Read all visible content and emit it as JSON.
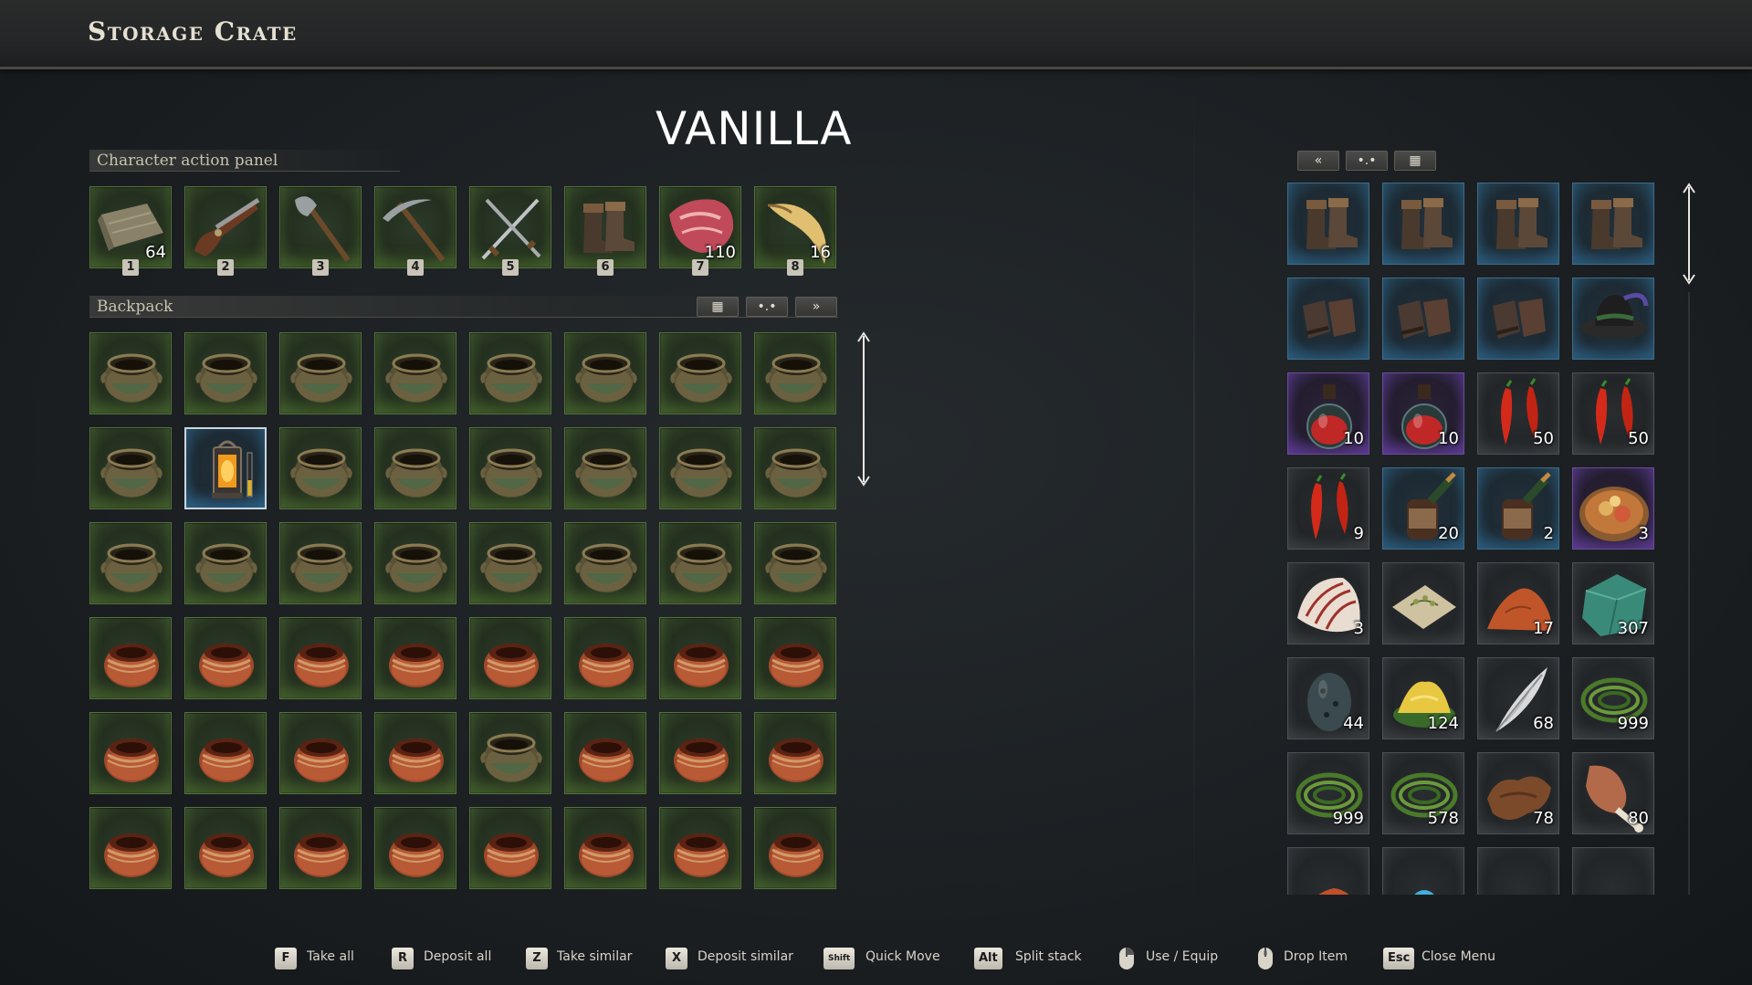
{
  "window": {
    "title": "Storage Crate"
  },
  "overlay": {
    "title": "VANILLA"
  },
  "action_panel": {
    "label": "Character action panel",
    "slots": [
      {
        "item": "cloth-icon",
        "qty": "64",
        "hotkey": "1"
      },
      {
        "item": "flintlock-pistol-icon",
        "qty": "",
        "hotkey": "2"
      },
      {
        "item": "axe-icon",
        "qty": "",
        "hotkey": "3"
      },
      {
        "item": "pickaxe-icon",
        "qty": "",
        "hotkey": "4"
      },
      {
        "item": "crossed-swords-icon",
        "qty": "",
        "hotkey": "5"
      },
      {
        "item": "boots-icon",
        "qty": "",
        "hotkey": "6"
      },
      {
        "item": "raw-meat-icon",
        "qty": "110",
        "hotkey": "7"
      },
      {
        "item": "horn-icon",
        "qty": "16",
        "hotkey": "8"
      }
    ]
  },
  "backpack": {
    "label": "Backpack",
    "buttons": {
      "grid": "▦",
      "sort": "•.•",
      "transfer": "»"
    },
    "rows": [
      [
        "green-pot",
        "green-pot",
        "green-pot",
        "green-pot",
        "green-pot",
        "green-pot",
        "green-pot",
        "green-pot"
      ],
      [
        "green-pot",
        "lantern",
        "green-pot",
        "green-pot",
        "green-pot",
        "green-pot",
        "green-pot",
        "green-pot"
      ],
      [
        "green-pot",
        "green-pot",
        "green-pot",
        "green-pot",
        "green-pot",
        "green-pot",
        "green-pot",
        "green-pot"
      ],
      [
        "clay-pot",
        "clay-pot",
        "clay-pot",
        "clay-pot",
        "clay-pot",
        "clay-pot",
        "clay-pot",
        "clay-pot"
      ],
      [
        "clay-pot",
        "clay-pot",
        "clay-pot",
        "clay-pot",
        "green-pot",
        "clay-pot",
        "clay-pot",
        "clay-pot"
      ],
      [
        "clay-pot",
        "clay-pot",
        "clay-pot",
        "clay-pot",
        "clay-pot",
        "clay-pot",
        "clay-pot",
        "clay-pot"
      ]
    ]
  },
  "storage": {
    "buttons": {
      "transfer": "«",
      "sort": "•.•",
      "grid": "▦"
    },
    "rows": [
      [
        {
          "item": "boots-icon",
          "qty": "",
          "rarity": "blue"
        },
        {
          "item": "boots-icon",
          "qty": "",
          "rarity": "blue"
        },
        {
          "item": "boots-icon",
          "qty": "",
          "rarity": "blue"
        },
        {
          "item": "boots-icon",
          "qty": "",
          "rarity": "blue"
        }
      ],
      [
        {
          "item": "gloves-icon",
          "qty": "",
          "rarity": "blue"
        },
        {
          "item": "gloves-icon",
          "qty": "",
          "rarity": "blue"
        },
        {
          "item": "gloves-icon",
          "qty": "",
          "rarity": "blue"
        },
        {
          "item": "hat-icon",
          "qty": "",
          "rarity": "blue"
        }
      ],
      [
        {
          "item": "potion-icon",
          "qty": "10",
          "rarity": "purple"
        },
        {
          "item": "potion-icon",
          "qty": "10",
          "rarity": "purple"
        },
        {
          "item": "chili-icon",
          "qty": "50",
          "rarity": "grey"
        },
        {
          "item": "chili-icon",
          "qty": "50",
          "rarity": "grey"
        }
      ],
      [
        {
          "item": "chili-icon",
          "qty": "9",
          "rarity": "grey"
        },
        {
          "item": "bottle-icon",
          "qty": "20",
          "rarity": "blue"
        },
        {
          "item": "bottle-icon",
          "qty": "2",
          "rarity": "blue"
        },
        {
          "item": "food-plate-icon",
          "qty": "3",
          "rarity": "purple"
        }
      ],
      [
        {
          "item": "shell-icon",
          "qty": "3",
          "rarity": "grey"
        },
        {
          "item": "seeds-icon",
          "qty": "",
          "rarity": "grey"
        },
        {
          "item": "clay-icon",
          "qty": "17",
          "rarity": "grey"
        },
        {
          "item": "ore-icon",
          "qty": "307",
          "rarity": "grey"
        }
      ],
      [
        {
          "item": "egg-icon",
          "qty": "44",
          "rarity": "grey"
        },
        {
          "item": "flour-icon",
          "qty": "124",
          "rarity": "grey"
        },
        {
          "item": "feather-icon",
          "qty": "68",
          "rarity": "grey"
        },
        {
          "item": "fiber-icon",
          "qty": "999",
          "rarity": "grey"
        }
      ],
      [
        {
          "item": "fiber-icon",
          "qty": "999",
          "rarity": "grey"
        },
        {
          "item": "fiber-icon",
          "qty": "578",
          "rarity": "grey"
        },
        {
          "item": "hide-icon",
          "qty": "78",
          "rarity": "grey"
        },
        {
          "item": "meat-leg-icon",
          "qty": "80",
          "rarity": "grey"
        }
      ],
      [
        {
          "item": "mushroom-icon",
          "qty": "",
          "rarity": "grey"
        },
        {
          "item": "flower-icon",
          "qty": "",
          "rarity": "grey"
        },
        {
          "item": "dirt-icon",
          "qty": "",
          "rarity": "grey"
        },
        {
          "item": "coins-icon",
          "qty": "",
          "rarity": "grey"
        }
      ]
    ]
  },
  "footer": [
    {
      "key": "F",
      "label": "Take all"
    },
    {
      "key": "R",
      "label": "Deposit all"
    },
    {
      "key": "Z",
      "label": "Take similar"
    },
    {
      "key": "X",
      "label": "Deposit similar"
    },
    {
      "key": "Shift",
      "label": "Quick Move"
    },
    {
      "key": "Alt",
      "label": "Split stack"
    },
    {
      "key": "mouse-right-icon",
      "label": "Use / Equip"
    },
    {
      "key": "mouse-middle-icon",
      "label": "Drop Item"
    },
    {
      "key": "Esc",
      "label": "Close Menu"
    }
  ],
  "colors": {
    "green_slot": "#55703f",
    "blue_slot": "#3f6a86",
    "purple_slot": "#6a4c96",
    "grey_slot": "#4c5054"
  }
}
